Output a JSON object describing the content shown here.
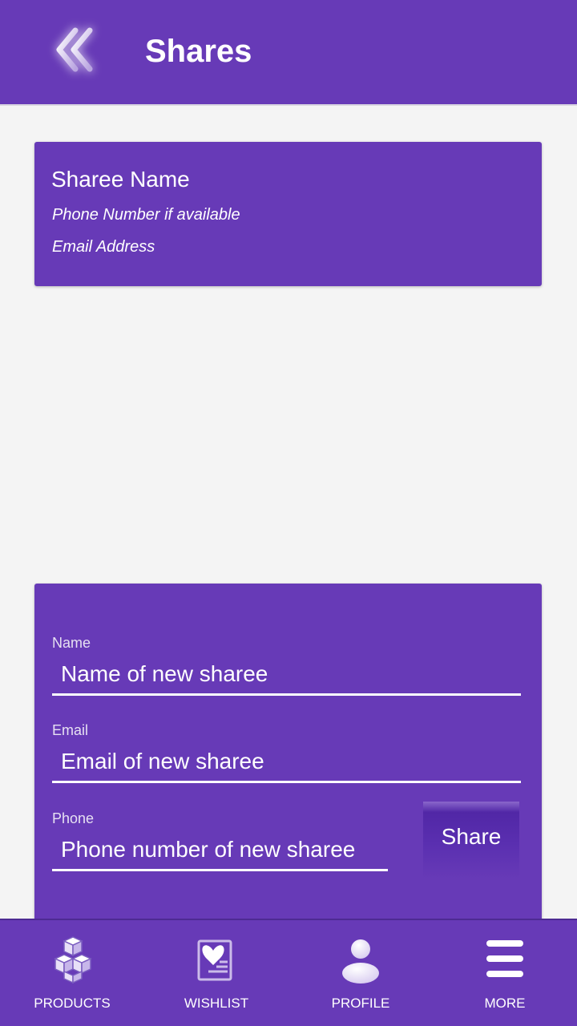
{
  "header": {
    "title": "Shares",
    "back_icon": "double-chevron-left-icon"
  },
  "sharee": {
    "name": "Sharee Name",
    "phone": "Phone Number if available",
    "email": "Email Address"
  },
  "form": {
    "name_label": "Name",
    "name_placeholder": "Name of new sharee",
    "email_label": "Email",
    "email_placeholder": "Email of new sharee",
    "phone_label": "Phone",
    "phone_placeholder": "Phone number of new sharee",
    "share_label": "Share"
  },
  "nav": {
    "items": [
      {
        "label": "PRODUCTS",
        "icon": "boxes-icon"
      },
      {
        "label": "WISHLIST",
        "icon": "heart-list-icon"
      },
      {
        "label": "PROFILE",
        "icon": "person-icon"
      },
      {
        "label": "MORE",
        "icon": "menu-icon"
      }
    ]
  },
  "colors": {
    "primary": "#673ab7",
    "background": "#f4f4f4",
    "text": "#ffffff"
  }
}
